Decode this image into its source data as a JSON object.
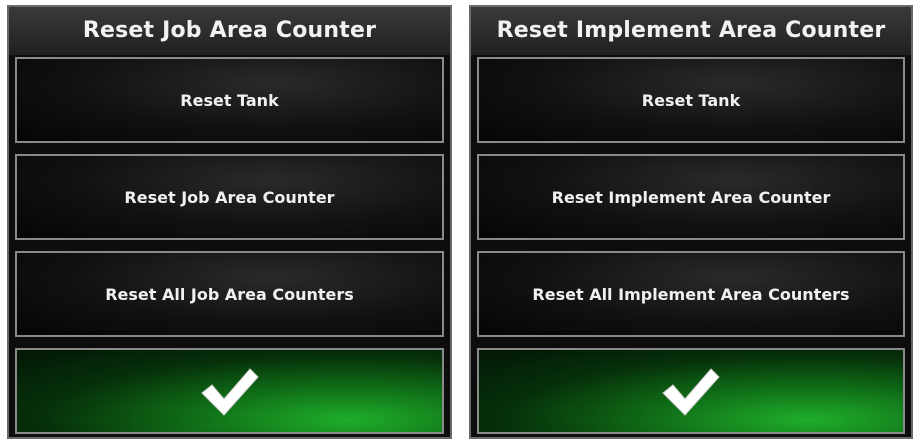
{
  "left_panel": {
    "title": "Reset Job Area Counter",
    "buttons": [
      {
        "label": "Reset Tank"
      },
      {
        "label": "Reset Job Area Counter"
      },
      {
        "label": "Reset All Job Area Counters"
      }
    ],
    "confirm_icon": "checkmark-icon"
  },
  "right_panel": {
    "title": "Reset Implement Area Counter",
    "buttons": [
      {
        "label": "Reset Tank"
      },
      {
        "label": "Reset Implement Area Counter"
      },
      {
        "label": "Reset All Implement Area Counters"
      }
    ],
    "confirm_icon": "checkmark-icon"
  },
  "colors": {
    "panel_background": "#0d0d0d",
    "button_border": "#8a8a8a",
    "confirm_green": "#1fae2a",
    "text": "#f0f0f0"
  }
}
